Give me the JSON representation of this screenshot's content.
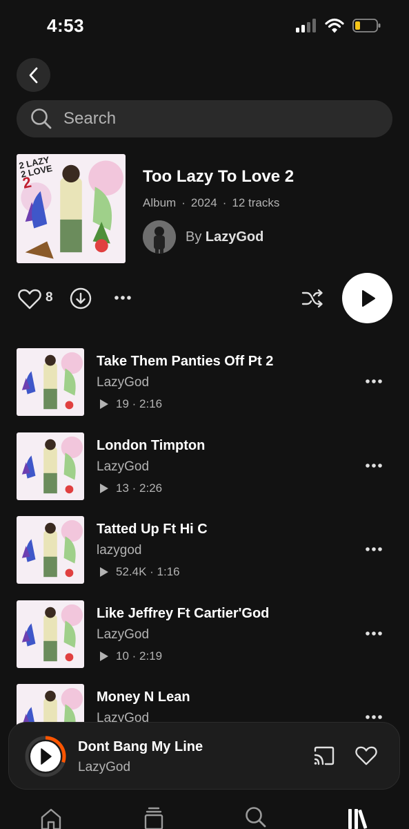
{
  "status_bar": {
    "time": "4:53"
  },
  "search": {
    "label": "Search"
  },
  "album": {
    "title": "Too Lazy To Love 2",
    "type": "Album",
    "year": "2024",
    "tracks_count": "12 tracks",
    "by_prefix": "By",
    "artist": "LazyGod",
    "cover_lettering": "2 LAZY 2 LOVE 2"
  },
  "actions": {
    "like_count": "8"
  },
  "tracks": [
    {
      "title": "Take Them Panties Off Pt 2",
      "artist": "LazyGod",
      "plays": "19",
      "duration": "2:16"
    },
    {
      "title": "London Timpton",
      "artist": "LazyGod",
      "plays": "13",
      "duration": "2:26"
    },
    {
      "title": "Tatted Up Ft Hi C",
      "artist": "lazygod",
      "plays": "52.4K",
      "duration": "1:16"
    },
    {
      "title": "Like Jeffrey Ft Cartier'God",
      "artist": "LazyGod",
      "plays": "10",
      "duration": "2:19"
    },
    {
      "title": "Money N Lean",
      "artist": "LazyGod",
      "plays": "",
      "duration": ""
    }
  ],
  "now_playing": {
    "title": "Dont Bang My Line",
    "artist": "LazyGod",
    "progress": 0.3
  },
  "nav": {
    "items": [
      "home-icon",
      "feed-icon",
      "search-icon",
      "library-icon"
    ],
    "active": "library-icon"
  },
  "colors": {
    "background": "#121212",
    "surface": "#2a2a2a",
    "secondary_text": "#b3b3b3",
    "progress_accent": "#ff5500"
  }
}
